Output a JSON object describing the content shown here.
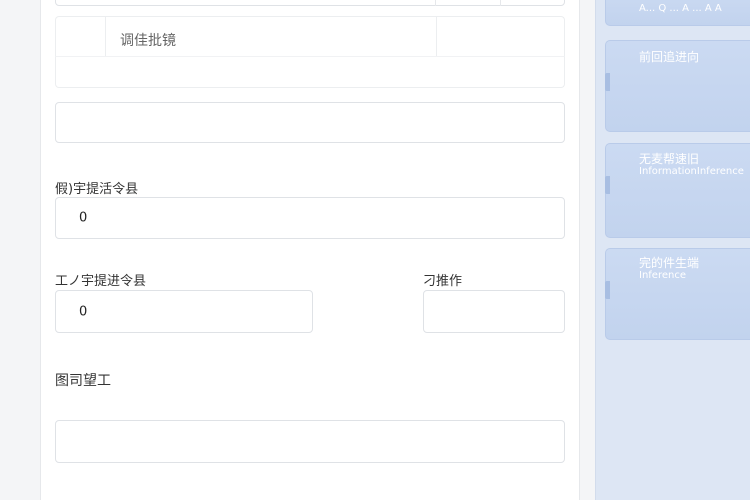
{
  "form": {
    "search_text": "调佳批镜",
    "field1_label": "假)宇提活令县",
    "field1_value": "0",
    "field2_label": "工ノ宇提进令县",
    "field2_value": "0",
    "field3_label": "刁推作",
    "field3_value": "",
    "field4_label": "图司望工",
    "field4_value": "",
    "blank_field_value": ""
  },
  "sidebar": {
    "card0_title": "A...  Q  ...  A  ...  A  A",
    "card1_title": "前回追进向",
    "card2_title": "无麦帮速旧",
    "card2_subtitle": "InformationInference",
    "card3_title": "完的件生端",
    "card3_subtitle": "Inference"
  },
  "colors": {
    "sidebar_bg": "#dde6f4",
    "card_bg": "#c7d7f0",
    "field_border": "#dfe2e6"
  }
}
